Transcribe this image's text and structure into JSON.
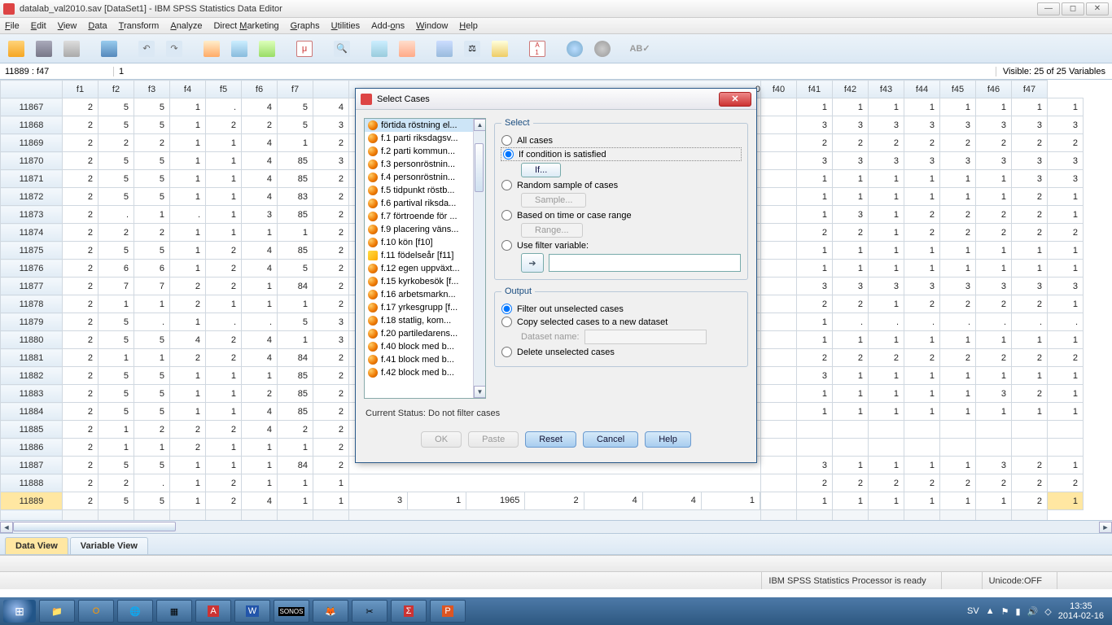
{
  "window": {
    "title": "datalab_val2010.sav [DataSet1] - IBM SPSS Statistics Data Editor"
  },
  "menu": [
    "File",
    "Edit",
    "View",
    "Data",
    "Transform",
    "Analyze",
    "Direct Marketing",
    "Graphs",
    "Utilities",
    "Add-ons",
    "Window",
    "Help"
  ],
  "menu_accel": [
    "F",
    "E",
    "V",
    "D",
    "T",
    "A",
    "M",
    "G",
    "U",
    "o",
    "W",
    "H"
  ],
  "infobar": {
    "cell": "11889 : f47",
    "value": "1",
    "visible": "Visible: 25 of 25 Variables"
  },
  "columns_left": [
    "f1",
    "f2",
    "f3",
    "f4",
    "f5",
    "f6",
    "f7"
  ],
  "columns_right": [
    "f40",
    "f41",
    "f42",
    "f43",
    "f44",
    "f45",
    "f46",
    "f47"
  ],
  "mid_col_label_frag": "0",
  "row_under_dialog": {
    "id": "11889",
    "cells": [
      "3",
      "1",
      "1965",
      "2",
      "4",
      "4",
      "1"
    ]
  },
  "rows": [
    {
      "id": "11867",
      "l": [
        "2",
        "5",
        "5",
        "1",
        ".",
        "4",
        "5",
        "4"
      ],
      "r": [
        "1",
        "1",
        "1",
        "1",
        "1",
        "1",
        "1",
        "1"
      ]
    },
    {
      "id": "11868",
      "l": [
        "2",
        "5",
        "5",
        "1",
        "2",
        "2",
        "5",
        "3"
      ],
      "r": [
        "3",
        "3",
        "3",
        "3",
        "3",
        "3",
        "3",
        "3"
      ]
    },
    {
      "id": "11869",
      "l": [
        "2",
        "2",
        "2",
        "1",
        "1",
        "4",
        "1",
        "2"
      ],
      "r": [
        "2",
        "2",
        "2",
        "2",
        "2",
        "2",
        "2",
        "2"
      ]
    },
    {
      "id": "11870",
      "l": [
        "2",
        "5",
        "5",
        "1",
        "1",
        "4",
        "85",
        "3"
      ],
      "r": [
        "3",
        "3",
        "3",
        "3",
        "3",
        "3",
        "3",
        "3"
      ]
    },
    {
      "id": "11871",
      "l": [
        "2",
        "5",
        "5",
        "1",
        "1",
        "4",
        "85",
        "2"
      ],
      "r": [
        "1",
        "1",
        "1",
        "1",
        "1",
        "1",
        "3",
        "3"
      ]
    },
    {
      "id": "11872",
      "l": [
        "2",
        "5",
        "5",
        "1",
        "1",
        "4",
        "83",
        "2"
      ],
      "r": [
        "1",
        "1",
        "1",
        "1",
        "1",
        "1",
        "2",
        "1"
      ]
    },
    {
      "id": "11873",
      "l": [
        "2",
        ".",
        "1",
        ".",
        "1",
        "3",
        "85",
        "2"
      ],
      "r": [
        "1",
        "3",
        "1",
        "2",
        "2",
        "2",
        "2",
        "1"
      ]
    },
    {
      "id": "11874",
      "l": [
        "2",
        "2",
        "2",
        "1",
        "1",
        "1",
        "1",
        "2"
      ],
      "r": [
        "2",
        "2",
        "1",
        "2",
        "2",
        "2",
        "2",
        "2"
      ]
    },
    {
      "id": "11875",
      "l": [
        "2",
        "5",
        "5",
        "1",
        "2",
        "4",
        "85",
        "2"
      ],
      "r": [
        "1",
        "1",
        "1",
        "1",
        "1",
        "1",
        "1",
        "1"
      ]
    },
    {
      "id": "11876",
      "l": [
        "2",
        "6",
        "6",
        "1",
        "2",
        "4",
        "5",
        "2"
      ],
      "r": [
        "1",
        "1",
        "1",
        "1",
        "1",
        "1",
        "1",
        "1"
      ]
    },
    {
      "id": "11877",
      "l": [
        "2",
        "7",
        "7",
        "2",
        "2",
        "1",
        "84",
        "2"
      ],
      "r": [
        "3",
        "3",
        "3",
        "3",
        "3",
        "3",
        "3",
        "3"
      ]
    },
    {
      "id": "11878",
      "l": [
        "2",
        "1",
        "1",
        "2",
        "1",
        "1",
        "1",
        "2"
      ],
      "r": [
        "2",
        "2",
        "1",
        "2",
        "2",
        "2",
        "2",
        "1"
      ]
    },
    {
      "id": "11879",
      "l": [
        "2",
        "5",
        ".",
        "1",
        ".",
        ".",
        "5",
        "3"
      ],
      "r": [
        "1",
        ".",
        ".",
        ".",
        ".",
        ".",
        ".",
        "."
      ]
    },
    {
      "id": "11880",
      "l": [
        "2",
        "5",
        "5",
        "4",
        "2",
        "4",
        "1",
        "3"
      ],
      "r": [
        "1",
        "1",
        "1",
        "1",
        "1",
        "1",
        "1",
        "1"
      ]
    },
    {
      "id": "11881",
      "l": [
        "2",
        "1",
        "1",
        "2",
        "2",
        "4",
        "84",
        "2"
      ],
      "r": [
        "2",
        "2",
        "2",
        "2",
        "2",
        "2",
        "2",
        "2"
      ]
    },
    {
      "id": "11882",
      "l": [
        "2",
        "5",
        "5",
        "1",
        "1",
        "1",
        "85",
        "2"
      ],
      "r": [
        "3",
        "1",
        "1",
        "1",
        "1",
        "1",
        "1",
        "1"
      ]
    },
    {
      "id": "11883",
      "l": [
        "2",
        "5",
        "5",
        "1",
        "1",
        "2",
        "85",
        "2"
      ],
      "r": [
        "1",
        "1",
        "1",
        "1",
        "1",
        "3",
        "2",
        "1"
      ]
    },
    {
      "id": "11884",
      "l": [
        "2",
        "5",
        "5",
        "1",
        "1",
        "4",
        "85",
        "2"
      ],
      "r": [
        "1",
        "1",
        "1",
        "1",
        "1",
        "1",
        "1",
        "1"
      ]
    },
    {
      "id": "11885",
      "l": [
        "2",
        "1",
        "2",
        "2",
        "2",
        "4",
        "2",
        "2"
      ],
      "r": [
        "",
        "",
        "",
        "",
        "",
        "",
        "",
        ""
      ]
    },
    {
      "id": "11886",
      "l": [
        "2",
        "1",
        "1",
        "2",
        "1",
        "1",
        "1",
        "2"
      ],
      "r": [
        "",
        "",
        "",
        "",
        "",
        "",
        "",
        ""
      ]
    },
    {
      "id": "11887",
      "l": [
        "2",
        "5",
        "5",
        "1",
        "1",
        "1",
        "84",
        "2"
      ],
      "r": [
        "3",
        "1",
        "1",
        "1",
        "1",
        "3",
        "2",
        "1"
      ]
    },
    {
      "id": "11888",
      "l": [
        "2",
        "2",
        ".",
        "1",
        "2",
        "1",
        "1",
        "1"
      ],
      "r": [
        "2",
        "2",
        "2",
        "2",
        "2",
        "2",
        "2",
        "2"
      ]
    },
    {
      "id": "11889",
      "l": [
        "2",
        "5",
        "5",
        "1",
        "2",
        "4",
        "1",
        "1"
      ],
      "r": [
        "1",
        "1",
        "1",
        "1",
        "1",
        "1",
        "2",
        "1"
      ],
      "sel": true
    }
  ],
  "tabs": {
    "data": "Data View",
    "var": "Variable View"
  },
  "status": {
    "processor": "IBM SPSS Statistics Processor is ready",
    "unicode": "Unicode:OFF"
  },
  "dialog": {
    "title": "Select Cases",
    "variables": [
      "förtida röstning el...",
      "f.1 parti riksdagsv...",
      "f.2 parti kommun...",
      "f.3 personröstnin...",
      "f.4 personröstnin...",
      "f.5 tidpunkt röstb...",
      "f.6 partival riksda...",
      "f.7 förtroende för ...",
      "f.9 placering väns...",
      "f.10 kön [f10]",
      "f.11 födelseår [f11]",
      "f.12 egen uppväxt...",
      "f.15 kyrkobesök [f...",
      "f.16 arbetsmarkn...",
      "f.17 yrkesgrupp [f...",
      "f.18 statlig, kom...",
      "f.20 partiledarens...",
      "f.40 block med b...",
      "f.41 block med b...",
      "f.42 block med b..."
    ],
    "select": {
      "legend": "Select",
      "all": "All cases",
      "cond": "If condition is satisfied",
      "if_btn": "If...",
      "rand": "Random sample of cases",
      "sample_btn": "Sample...",
      "range": "Based on time or case range",
      "range_btn": "Range...",
      "filter": "Use filter variable:"
    },
    "output": {
      "legend": "Output",
      "filter_out": "Filter out unselected cases",
      "copy": "Copy selected cases to a new dataset",
      "dsname": "Dataset name:",
      "delete": "Delete unselected cases"
    },
    "status_line": "Current Status: Do not filter cases",
    "buttons": {
      "ok": "OK",
      "paste": "Paste",
      "reset": "Reset",
      "cancel": "Cancel",
      "help": "Help"
    }
  },
  "tray": {
    "lang": "SV",
    "time": "13:35",
    "date": "2014-02-16"
  }
}
